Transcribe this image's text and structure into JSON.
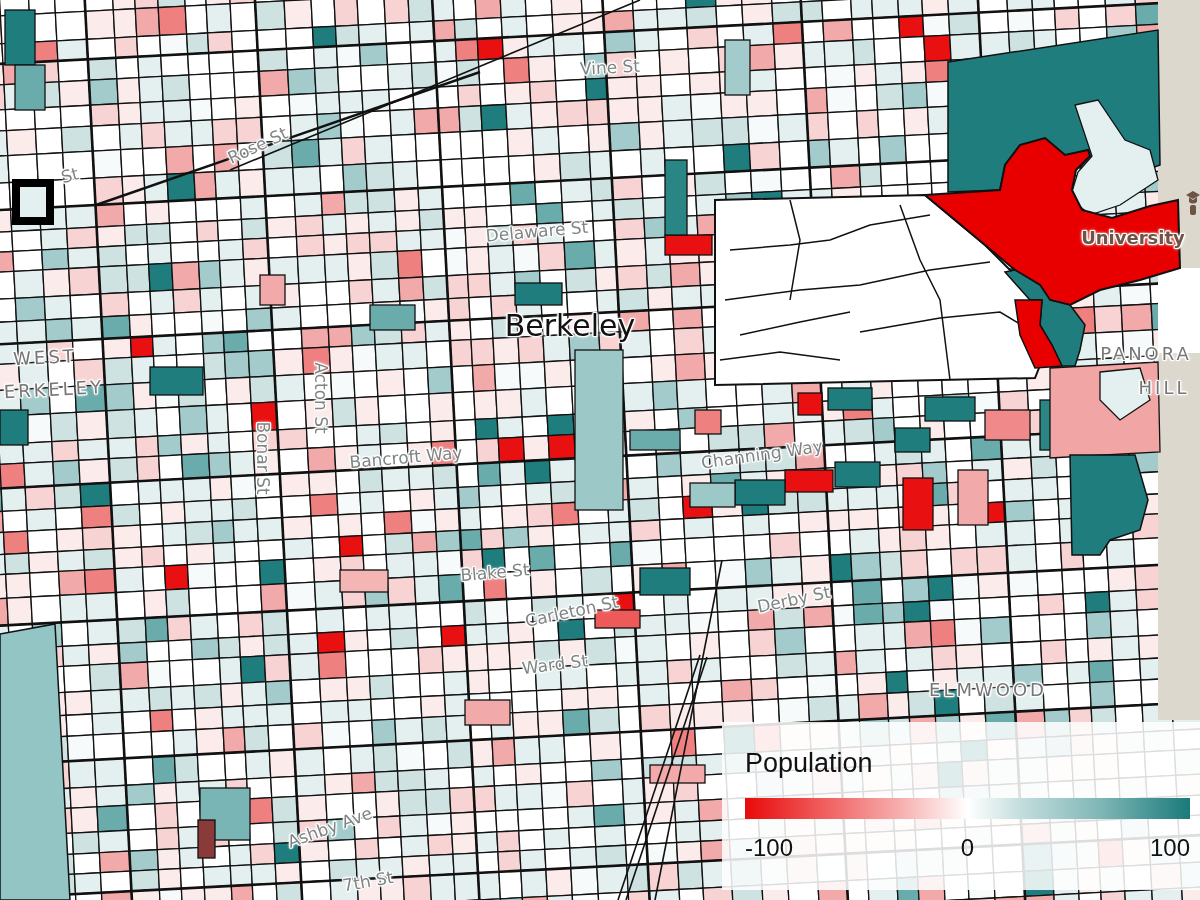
{
  "map": {
    "labels": [
      {
        "text": "Vine St",
        "kind": "street"
      },
      {
        "text": "Rose St",
        "kind": "street"
      },
      {
        "text": "St",
        "kind": "street"
      },
      {
        "text": "Delaware St",
        "kind": "street"
      },
      {
        "text": "University",
        "kind": "landmark"
      },
      {
        "text": "Berkeley",
        "kind": "city"
      },
      {
        "text": "PANORA",
        "kind": "district"
      },
      {
        "text": "WEST",
        "kind": "district"
      },
      {
        "text": "HILL",
        "kind": "district"
      },
      {
        "text": "ERKELEY",
        "kind": "district"
      },
      {
        "text": "Acton St",
        "kind": "street"
      },
      {
        "text": "Channing Way",
        "kind": "street"
      },
      {
        "text": "Bancroft Way",
        "kind": "street"
      },
      {
        "text": "Bonar St",
        "kind": "street"
      },
      {
        "text": "Blake St",
        "kind": "street"
      },
      {
        "text": "Derby St",
        "kind": "street"
      },
      {
        "text": "Carleton St",
        "kind": "street"
      },
      {
        "text": "Ward St",
        "kind": "street"
      },
      {
        "text": "ELMWOOD",
        "kind": "district"
      },
      {
        "text": "Ashby Ave",
        "kind": "street"
      },
      {
        "text": "7th St",
        "kind": "street"
      }
    ]
  },
  "legend": {
    "title": "Population",
    "ticks": [
      "-100",
      "0",
      "100"
    ]
  }
}
